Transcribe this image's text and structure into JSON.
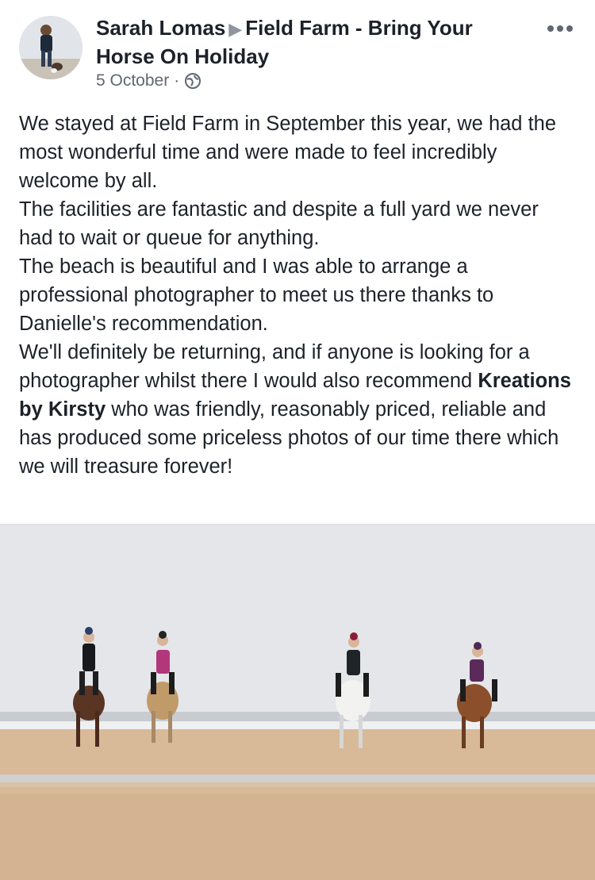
{
  "post": {
    "author": "Sarah Lomas",
    "target_page": "Field Farm - Bring Your Horse On Holiday",
    "date": "5 October",
    "separator": "·",
    "audience_icon": "globe-icon",
    "more_icon": "more-options-icon",
    "text": {
      "line1": "We stayed at Field Farm in September this year, we had the most wonderful time and were made to feel incredibly welcome by all.",
      "line2": "The facilities are fantastic and despite a full yard we never had to wait or queue for anything.",
      "line3": "The beach is beautiful and I was able to arrange a professional photographer to meet us there thanks to Danielle's recommendation.",
      "line4_start": "We'll definitely be returning, and if anyone is looking for a photographer whilst there I would also recommend ",
      "line4_bold": "Kreations by Kirsty",
      "line4_end": " who was friendly, reasonably priced, reliable and has produced some priceless photos of our time there which we will treasure forever!"
    }
  },
  "colors": {
    "text": "#1d2129",
    "secondary": "#616770",
    "sky": "#e3e6ea",
    "sand": "#d7b796"
  }
}
